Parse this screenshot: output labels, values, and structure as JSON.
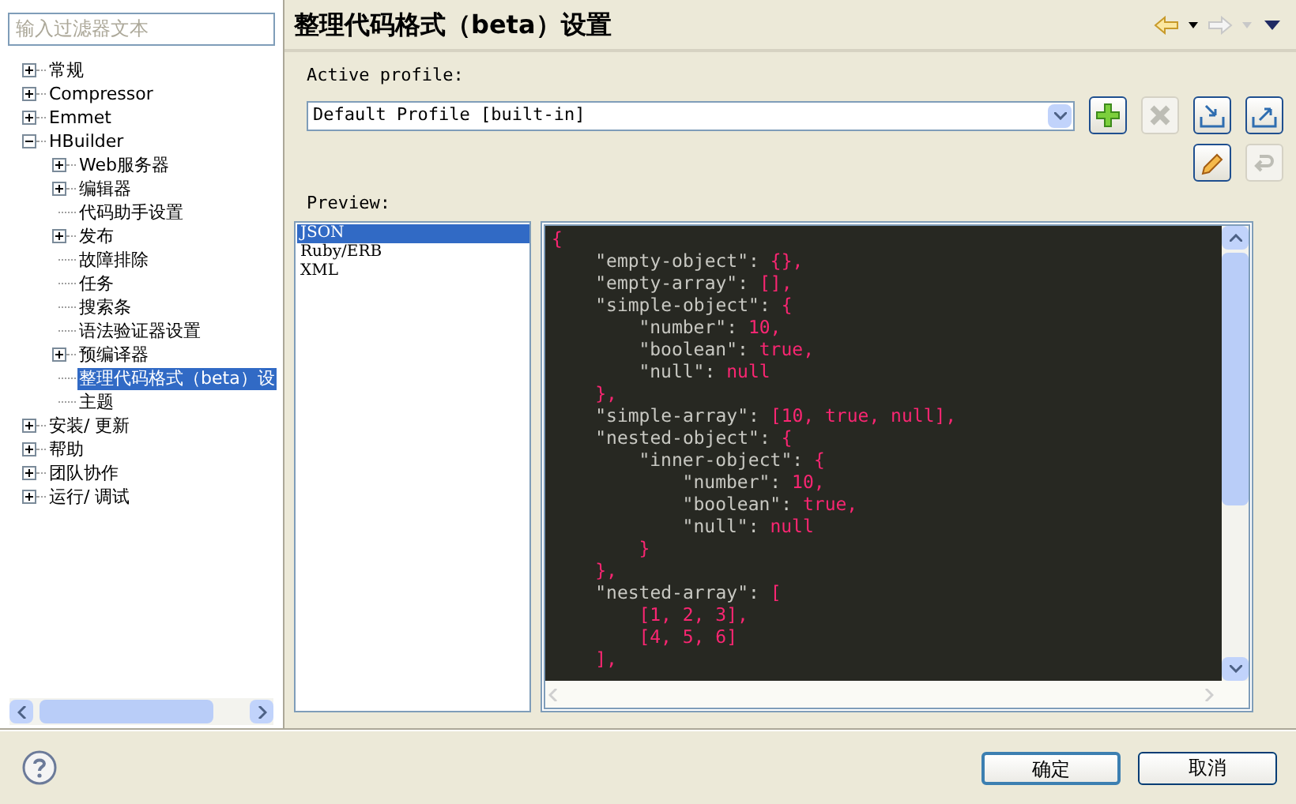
{
  "sidebar": {
    "filter": {
      "placeholder": "输入过滤器文本"
    },
    "tree": [
      {
        "label": "常规",
        "kind": "node",
        "expanded": false,
        "selected": false
      },
      {
        "label": "Compressor",
        "kind": "node",
        "expanded": false,
        "selected": false
      },
      {
        "label": "Emmet",
        "kind": "node",
        "expanded": false,
        "selected": false
      },
      {
        "label": "HBuilder",
        "kind": "node",
        "expanded": true,
        "selected": false,
        "children": [
          {
            "label": "Web服务器",
            "kind": "node",
            "expanded": false,
            "selected": false
          },
          {
            "label": "编辑器",
            "kind": "node",
            "expanded": false,
            "selected": false
          },
          {
            "label": "代码助手设置",
            "kind": "leaf",
            "selected": false
          },
          {
            "label": "发布",
            "kind": "node",
            "expanded": false,
            "selected": false
          },
          {
            "label": "故障排除",
            "kind": "leaf",
            "selected": false
          },
          {
            "label": "任务",
            "kind": "leaf",
            "selected": false
          },
          {
            "label": "搜索条",
            "kind": "leaf",
            "selected": false
          },
          {
            "label": "语法验证器设置",
            "kind": "leaf",
            "selected": false
          },
          {
            "label": "预编译器",
            "kind": "node",
            "expanded": false,
            "selected": false
          },
          {
            "label": "整理代码格式（beta）设",
            "kind": "leaf",
            "selected": true
          },
          {
            "label": "主题",
            "kind": "leaf",
            "selected": false
          }
        ]
      },
      {
        "label": "安装/ 更新",
        "kind": "node",
        "expanded": false,
        "selected": false
      },
      {
        "label": "帮助",
        "kind": "node",
        "expanded": false,
        "selected": false
      },
      {
        "label": "团队协作",
        "kind": "node",
        "expanded": false,
        "selected": false
      },
      {
        "label": "运行/ 调试",
        "kind": "node",
        "expanded": false,
        "selected": false
      }
    ]
  },
  "page": {
    "title": "整理代码格式（beta）设置",
    "active_profile_label": "Active profile:",
    "profile": {
      "value": "Default Profile [built-in]"
    },
    "toolbar": [
      {
        "kind": "new",
        "disabled": false
      },
      {
        "kind": "remove",
        "disabled": true
      },
      {
        "kind": "import",
        "disabled": false
      },
      {
        "kind": "export",
        "disabled": false
      },
      {
        "kind": "edit",
        "disabled": false
      },
      {
        "kind": "revert",
        "disabled": true
      }
    ],
    "preview_label": "Preview:",
    "languages": [
      {
        "label": "JSON",
        "selected": true
      },
      {
        "label": "Ruby/ERB",
        "selected": false
      },
      {
        "label": "XML",
        "selected": false
      }
    ],
    "code": [
      {
        "value": "{",
        "children": [
          {
            "key": "\"empty-object\":",
            "value": "{},"
          },
          {
            "key": "\"empty-array\":",
            "value": "[],"
          },
          {
            "key": "\"simple-object\":",
            "value": "{",
            "children": [
              {
                "key": "\"number\":",
                "value": "10,"
              },
              {
                "key": "\"boolean\":",
                "value": "true,"
              },
              {
                "key": "\"null\":",
                "value": "null"
              }
            ]
          },
          {
            "value": "},"
          },
          {
            "key": "\"simple-array\":",
            "value": "[10, true, null],"
          },
          {
            "key": "\"nested-object\":",
            "value": "{",
            "children": [
              {
                "key": "\"inner-object\":",
                "value": "{",
                "children": [
                  {
                    "key": "\"number\":",
                    "value": "10,"
                  },
                  {
                    "key": "\"boolean\":",
                    "value": "true,"
                  },
                  {
                    "key": "\"null\":",
                    "value": "null"
                  }
                ]
              },
              {
                "value": "}"
              }
            ]
          },
          {
            "value": "},"
          },
          {
            "key": "\"nested-array\":",
            "value": "[",
            "children": [
              {
                "value": "[1, 2, 3],"
              },
              {
                "value": "[4, 5, 6]"
              }
            ]
          },
          {
            "value": "],"
          }
        ]
      }
    ]
  },
  "buttons": [
    {
      "label": "确定",
      "default": true
    },
    {
      "label": "取消",
      "default": false
    }
  ]
}
